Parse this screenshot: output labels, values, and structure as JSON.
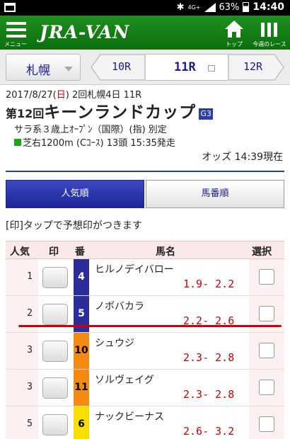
{
  "status": {
    "network": "4G+",
    "battery": "63%",
    "time": "14:40"
  },
  "header": {
    "brand": "JRA-VAN",
    "menu_label": "メニュー",
    "top_label": "トップ",
    "week_label": "今週のレース"
  },
  "nav": {
    "venue": "札幌",
    "prev_race": "10R",
    "current_race": "11R",
    "next_race": "12R"
  },
  "race": {
    "date": "2017/8/27(",
    "weekday": "日",
    "meeting": ") 2回札幌4日 11R",
    "race_no": "第12回",
    "name": "キーンランドカップ",
    "grade_badge": "G3",
    "conditions": "サラ系３歳上ｵｰﾌﾟﾝ（国際）(指) 別定",
    "course": "芝右1200m (Cｺｰｽ) 13頭 15:35発走",
    "odds_time": "オッズ 14:39現在"
  },
  "tabs": {
    "popularity": "人気順",
    "horse_number": "馬番順"
  },
  "hint": "[印]タップで予想印がつきます",
  "table": {
    "headers": {
      "rank": "人気",
      "mark": "印",
      "number": "番",
      "name": "馬名",
      "select": "選択"
    },
    "rows": [
      {
        "rank": "1",
        "number": "4",
        "name": "ヒルノデイバロー",
        "odds": "1.9- 2.2",
        "color": "#2c2c9a",
        "text": "#ffffff"
      },
      {
        "rank": "2",
        "number": "5",
        "name": "ノボバカラ",
        "odds": "2.2- 2.6",
        "color": "#2c2c9a",
        "text": "#ffffff"
      },
      {
        "rank": "3",
        "number": "10",
        "name": "シュウジ",
        "odds": "2.3- 2.8",
        "color": "#f58a10",
        "text": "#000000"
      },
      {
        "rank": "3",
        "number": "11",
        "name": "ソルヴェイグ",
        "odds": "2.3- 2.8",
        "color": "#f58a10",
        "text": "#000000"
      },
      {
        "rank": "5",
        "number": "6",
        "name": "ナックビーナス",
        "odds": "2.6- 3.2",
        "color": "#f7e000",
        "text": "#000000"
      }
    ]
  }
}
